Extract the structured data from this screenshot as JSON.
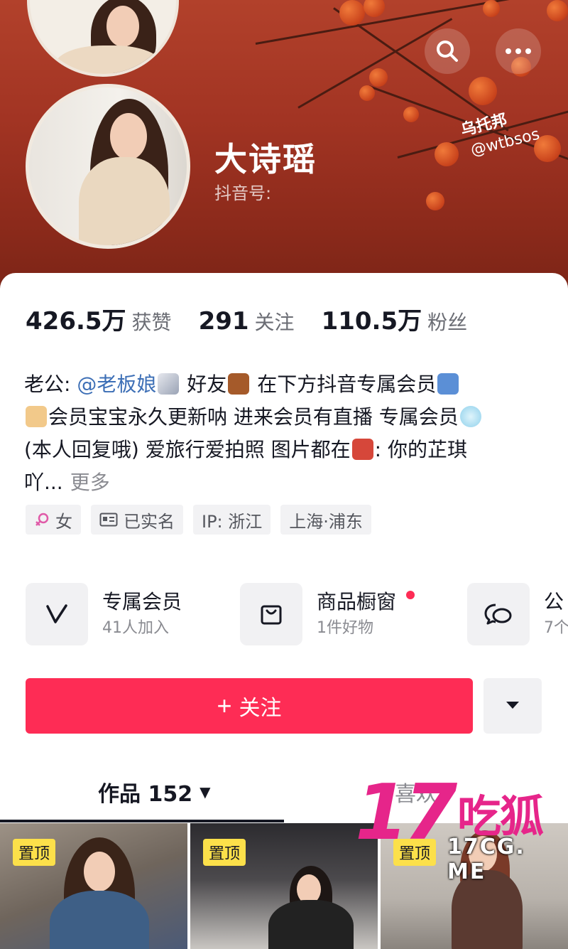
{
  "profile": {
    "nickname": "大诗瑶",
    "douyin_id_label": "抖音号:",
    "watermark_name": "乌托邦",
    "watermark_handle": "@wtbsos"
  },
  "header_icons": {
    "search": "search-icon",
    "more": "more-icon"
  },
  "stats": [
    {
      "value": "426.5万",
      "label": "获赞"
    },
    {
      "value": "291",
      "label": "关注"
    },
    {
      "value": "110.5万",
      "label": "粉丝"
    }
  ],
  "bio": {
    "line1_prefix": "老公:",
    "line1_mention": "@老板娘",
    "line1_mid": "好友",
    "line1_suffix": "在下方抖音专属会员",
    "line2": "会员宝宝永久更新呐 进来会员有直播  专属会员",
    "line3_prefix": "(本人回复哦) 爱旅行爱拍照 图片都在",
    "line3_suffix": ": 你的芷琪",
    "line4": "吖...",
    "more": "更多"
  },
  "tags": [
    {
      "icon": "female-icon",
      "label": "女"
    },
    {
      "icon": "id-card-icon",
      "label": "已实名"
    },
    {
      "icon": "",
      "label": "IP: 浙江"
    },
    {
      "icon": "",
      "label": "上海·浦东"
    }
  ],
  "services": [
    {
      "icon": "vip-icon",
      "title": "专属会员",
      "subtitle": "41人加入"
    },
    {
      "icon": "shop-bag-icon",
      "title": "商品橱窗",
      "subtitle": "1件好物"
    },
    {
      "icon": "chat-icon",
      "title": "公",
      "subtitle": "7个"
    }
  ],
  "actions": {
    "follow_label": "关注",
    "follow_plus": "+"
  },
  "tabs": {
    "works_label": "作品 152",
    "works_caret": "▼",
    "right_tab_partial": "喜欢"
  },
  "videos": [
    {
      "badge": "置顶"
    },
    {
      "badge": "置顶"
    },
    {
      "badge": "置顶"
    }
  ],
  "watermark": {
    "big": "17",
    "brand": "吃狐",
    "url": "17CG. ME"
  },
  "colors": {
    "accent": "#fe2c55",
    "mention": "#3d6fb6",
    "pin": "#fce04a",
    "watermark": "#e6258a"
  }
}
